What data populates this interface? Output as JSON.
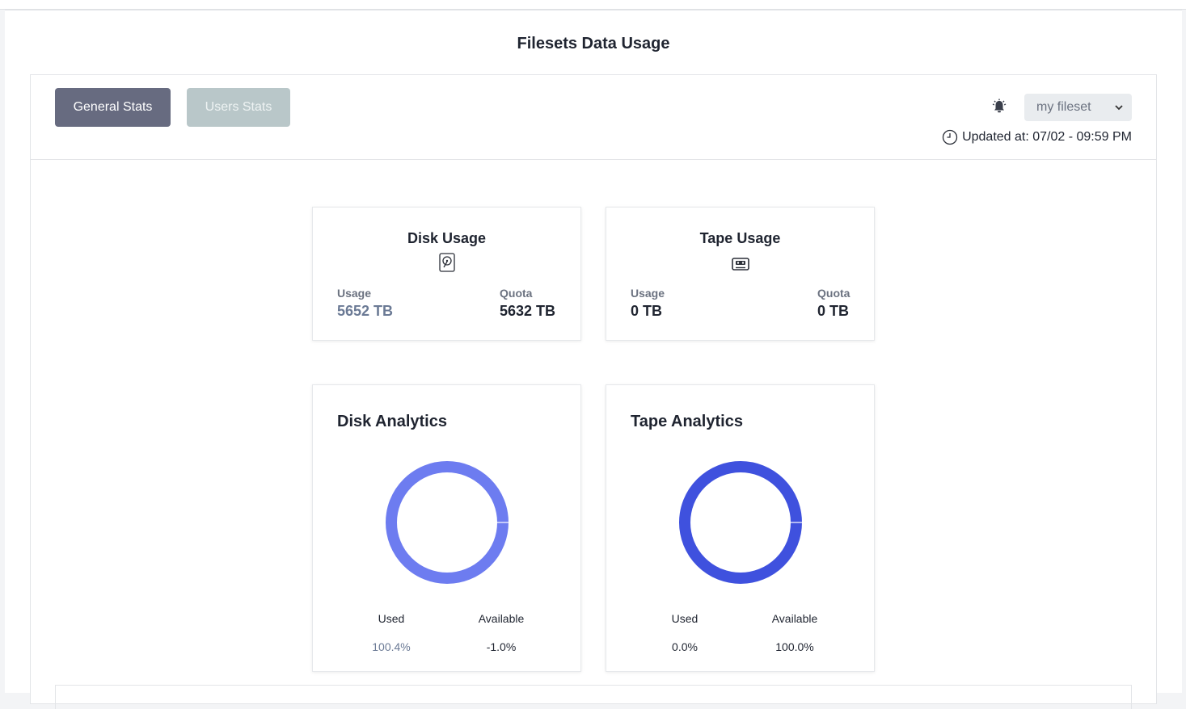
{
  "page": {
    "title": "Filesets Data Usage"
  },
  "tabs": {
    "general": "General Stats",
    "users": "Users Stats"
  },
  "fileset_select": {
    "value": "my fileset"
  },
  "updated": {
    "text": "Updated at: 07/02 - 09:59 PM"
  },
  "icons": {
    "bell": "bell-icon",
    "clock": "clock-icon",
    "disk": "hard-disk-icon",
    "tape": "tape-cassette-icon",
    "chevron": "chevron-down-icon"
  },
  "disk_usage": {
    "title": "Disk Usage",
    "usage_label": "Usage",
    "usage_value": "5652 TB",
    "quota_label": "Quota",
    "quota_value": "5632 TB"
  },
  "tape_usage": {
    "title": "Tape Usage",
    "usage_label": "Usage",
    "usage_value": "0 TB",
    "quota_label": "Quota",
    "quota_value": "0 TB"
  },
  "disk_analytics": {
    "title": "Disk Analytics",
    "used_label": "Used",
    "used_value": "100.4%",
    "available_label": "Available",
    "available_value": "-1.0%",
    "color": "#6d7cf0"
  },
  "tape_analytics": {
    "title": "Tape Analytics",
    "used_label": "Used",
    "used_value": "0.0%",
    "available_label": "Available",
    "available_value": "100.0%",
    "color": "#3f51de"
  },
  "chart_data": [
    {
      "type": "pie",
      "categories": [
        "Used",
        "Available"
      ],
      "values": [
        100.4,
        -1.0
      ]
    },
    {
      "type": "pie",
      "categories": [
        "Used",
        "Available"
      ],
      "values": [
        0.0,
        100.0
      ]
    }
  ]
}
